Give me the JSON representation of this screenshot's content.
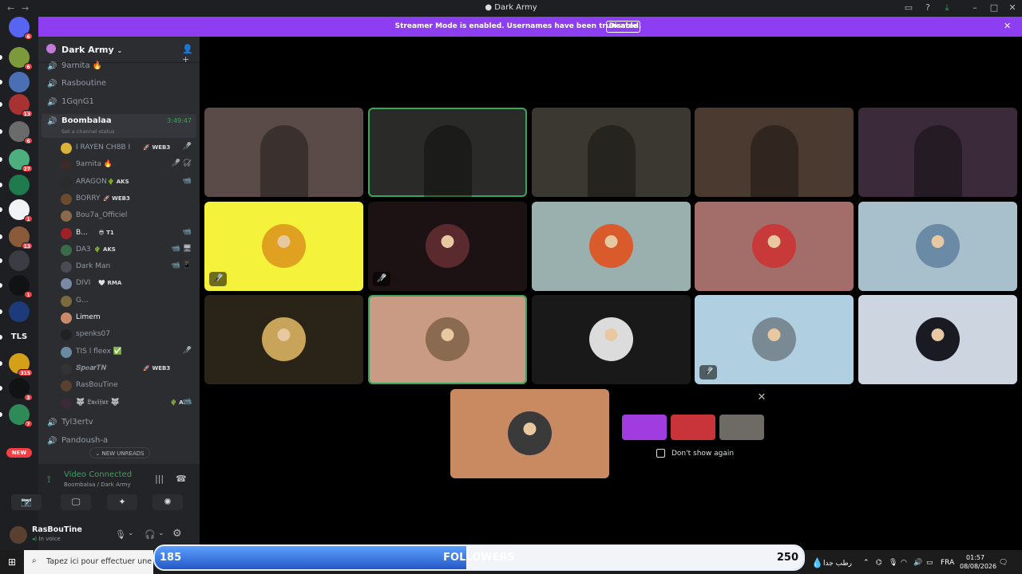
{
  "window": {
    "title": "Dark Army"
  },
  "banner": {
    "text": "Streamer Mode is enabled. Usernames have been truncated.",
    "button": "Disable"
  },
  "rail": {
    "servers": [
      {
        "name": "Direct Messages",
        "color": "#5865f2",
        "badge": "6"
      },
      {
        "name": "server-1",
        "color": "#7c9a3c",
        "badge": "6"
      },
      {
        "name": "server-2",
        "color": "#4a6fb5",
        "badge": ""
      },
      {
        "name": "server-3",
        "color": "#a83232",
        "badge": "13"
      },
      {
        "name": "server-4",
        "color": "#6b6b6b",
        "badge": "6"
      },
      {
        "name": "server-5",
        "color": "#4caf7d",
        "badge": "27"
      },
      {
        "name": "server-6",
        "color": "#1f7a4d",
        "badge": ""
      },
      {
        "name": "server-7",
        "color": "#f2f3f5",
        "badge": "1"
      },
      {
        "name": "server-8",
        "color": "#8a5a3a",
        "badge": "13"
      },
      {
        "name": "server-9",
        "color": "#3a3d44",
        "badge": ""
      },
      {
        "name": "server-10",
        "color": "#111214",
        "badge": "1"
      },
      {
        "name": "server-11",
        "color": "#1d3a7a",
        "badge": ""
      },
      {
        "name": "TLS",
        "color": "#2b2d31",
        "badge": ""
      },
      {
        "name": "server-13",
        "color": "#d4a017",
        "badge": "315"
      },
      {
        "name": "server-14",
        "color": "#111214",
        "badge": "3"
      },
      {
        "name": "server-15",
        "color": "#2e8b57",
        "badge": "7"
      }
    ],
    "new_label": "NEW"
  },
  "sidebar": {
    "server_name": "Dark Army",
    "channels_top": [
      "9arnita 🔥",
      "Rasboutine",
      "1GqnG1"
    ],
    "active_channel": {
      "name": "Boombalaa",
      "timer": "3:49:47",
      "status": "Set a channel status"
    },
    "members": [
      {
        "name": "I RAYEN CH8B I",
        "tag": "🚀 WEB3",
        "icon": "🎤̸",
        "avatar": "#d9b23a"
      },
      {
        "name": "9arnita 🔥",
        "tag": "",
        "icon": "🎤̸ 🎧̸",
        "avatar": "#3a2a2a"
      },
      {
        "name": "ARAGON",
        "tag": "🌵 AKS",
        "icon": "📹",
        "avatar": "#2b2b2b"
      },
      {
        "name": "BORRY",
        "tag": "🚀 WEB3",
        "icon": "",
        "avatar": "#6b4a2f"
      },
      {
        "name": "Bou7a_Officiel",
        "tag": "",
        "icon": "",
        "avatar": "#8a6a4a"
      },
      {
        "name": "B...",
        "tag": "😎 T1",
        "icon": "📹",
        "avatar": "#a0202a"
      },
      {
        "name": "DA3",
        "tag": "🌵 AKS",
        "icon": "📹 🖥",
        "avatar": "#3c6b4a"
      },
      {
        "name": "Dark Man",
        "tag": "",
        "icon": "📹 📱",
        "avatar": "#4a4a55"
      },
      {
        "name": "DIVI",
        "tag": "🤍 RMA",
        "icon": "",
        "avatar": "#7a8aa5"
      },
      {
        "name": "G...",
        "tag": "",
        "icon": "",
        "avatar": "#7a6a40"
      },
      {
        "name": "Limem",
        "tag": "",
        "icon": "",
        "avatar": "#c98a6a"
      },
      {
        "name": "spenks07",
        "tag": "",
        "icon": "",
        "avatar": "#222"
      },
      {
        "name": "TIS l fleex ✅",
        "tag": "",
        "icon": "🎤̸",
        "avatar": "#6a8aa0"
      },
      {
        "name": "𝑺𝒑𝒆𝒂𝒓𝑻𝑵",
        "tag": "🚀 WEB3",
        "icon": "",
        "avatar": "#333"
      },
      {
        "name": "RasBouTine",
        "tag": "",
        "icon": "",
        "avatar": "#5a4030"
      },
      {
        "name": "🐺 𝕷𝖚𝖈𝖎𝖋𝖚𝖗 🐺",
        "tag": "🌵 AKS",
        "icon": "📹",
        "avatar": "#3a2a3a"
      }
    ],
    "channels_bottom": [
      "Tyl3ertv",
      "Pandoush-a"
    ],
    "new_unreads": "NEW UNREADS"
  },
  "voice": {
    "status": "Video Connected",
    "location": "Boombalaa / Dark Army"
  },
  "user": {
    "name": "RasBouTine",
    "status": "In voice"
  },
  "stage": {
    "tiles": [
      {
        "kind": "video",
        "bg": "#5a4a48",
        "speaking": false,
        "muted": false
      },
      {
        "kind": "video",
        "bg": "#2a2a28",
        "speaking": true,
        "muted": false
      },
      {
        "kind": "video",
        "bg": "#3a3830",
        "speaking": false,
        "muted": false
      },
      {
        "kind": "video",
        "bg": "#4a3a30",
        "speaking": false,
        "muted": false
      },
      {
        "kind": "video",
        "bg": "#3a2a3a",
        "speaking": false,
        "muted": false
      },
      {
        "kind": "avatar",
        "bg": "#f5f23b",
        "avatar": "#e0a020",
        "speaking": false,
        "muted": true
      },
      {
        "kind": "avatar",
        "bg": "#1c1214",
        "avatar": "#5a2a2e",
        "speaking": false,
        "muted": true
      },
      {
        "kind": "avatar",
        "bg": "#9ab0ae",
        "avatar": "#d95a2a",
        "speaking": false,
        "muted": false
      },
      {
        "kind": "avatar",
        "bg": "#a36e6a",
        "avatar": "#c83a3a",
        "speaking": false,
        "muted": false
      },
      {
        "kind": "avatar",
        "bg": "#a8c0cc",
        "avatar": "#6a8aa5",
        "speaking": false,
        "muted": false
      },
      {
        "kind": "avatar",
        "bg": "#2a2418",
        "avatar": "#c8a45a",
        "speaking": false,
        "muted": false
      },
      {
        "kind": "avatar",
        "bg": "#c99a84",
        "avatar": "#8a6a50",
        "speaking": true,
        "muted": false
      },
      {
        "kind": "avatar",
        "bg": "#191919",
        "avatar": "#dcdcdc",
        "speaking": false,
        "muted": false
      },
      {
        "kind": "avatar",
        "bg": "#b0cfe0",
        "avatar": "#7a8a95",
        "speaking": false,
        "muted": true
      },
      {
        "kind": "avatar",
        "bg": "#cdd6e0",
        "avatar": "#1a1a22",
        "speaking": false,
        "muted": false
      },
      {
        "kind": "avatar",
        "bg": "#c98a62",
        "avatar": "#3a3a3a",
        "speaking": false,
        "muted": false
      }
    ],
    "popup": {
      "dont_show": "Don't show again",
      "thumbs": [
        "#a13de0",
        "#c8343a",
        "#6e6a66"
      ]
    }
  },
  "followers": {
    "label": "FOLLOWERS",
    "current": "185",
    "goal": "250",
    "progress": 0.48
  },
  "taskbar": {
    "search": "Tapez ici pour effectuer une re",
    "weather": "رطب جدا",
    "lang": "FRA",
    "time": "01:57",
    "date": "08/08/2026"
  }
}
